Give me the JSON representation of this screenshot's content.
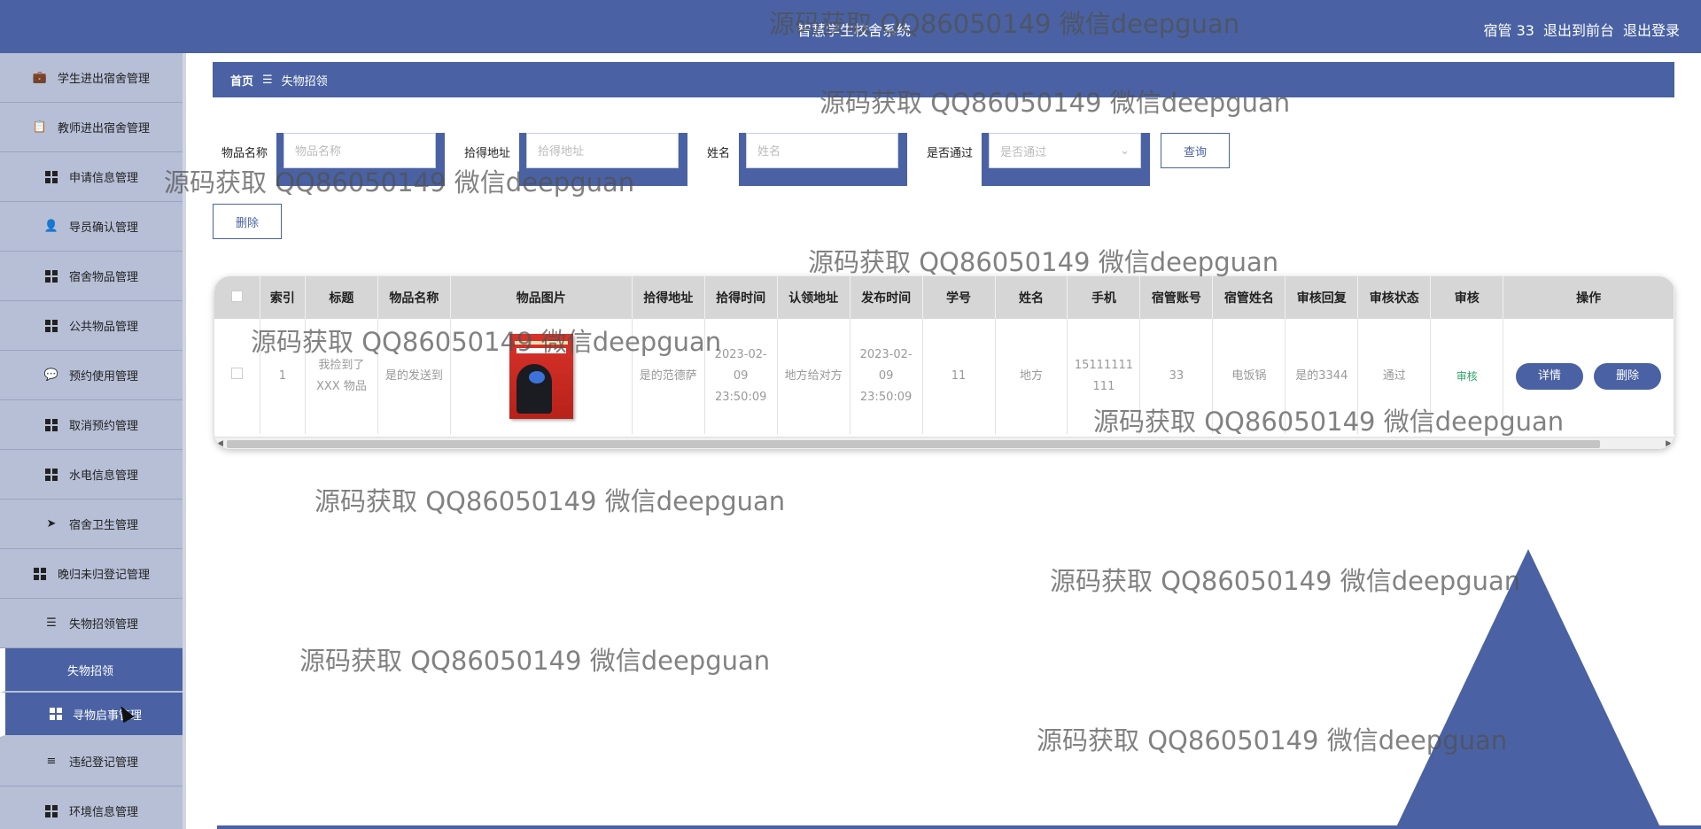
{
  "header": {
    "title": "智慧学生校舍系统",
    "user": "宿管 33",
    "to_front": "退出到前台",
    "logout": "退出登录"
  },
  "sidebar": {
    "items": [
      {
        "label": "学生进出宿舍管理",
        "icon": "briefcase-icon"
      },
      {
        "label": "教师进出宿舍管理",
        "icon": "clipboard-icon"
      },
      {
        "label": "申请信息管理",
        "icon": "grid-icon"
      },
      {
        "label": "导员确认管理",
        "icon": "user-icon"
      },
      {
        "label": "宿舍物品管理",
        "icon": "grid-icon"
      },
      {
        "label": "公共物品管理",
        "icon": "grid-icon"
      },
      {
        "label": "预约使用管理",
        "icon": "chat-icon"
      },
      {
        "label": "取消预约管理",
        "icon": "grid-icon"
      },
      {
        "label": "水电信息管理",
        "icon": "grid-icon"
      },
      {
        "label": "宿舍卫生管理",
        "icon": "paper-plane-icon"
      },
      {
        "label": "晚归未归登记管理",
        "icon": "grid-icon"
      },
      {
        "label": "失物招领管理",
        "icon": "sliders-icon"
      }
    ],
    "sub_active": "失物招领",
    "sub_next": "寻物启事管理",
    "after": [
      {
        "label": "违纪登记管理",
        "icon": "list-icon"
      },
      {
        "label": "环境信息管理",
        "icon": "grid-icon"
      }
    ]
  },
  "breadcrumb": {
    "home": "首页",
    "separator": "☰",
    "current": "失物招领"
  },
  "search": {
    "item_name_label": "物品名称",
    "item_name_placeholder": "物品名称",
    "pick_addr_label": "拾得地址",
    "pick_addr_placeholder": "拾得地址",
    "name_label": "姓名",
    "name_placeholder": "姓名",
    "pass_label": "是否通过",
    "pass_placeholder": "是否通过",
    "query_btn": "查询"
  },
  "delete_btn": "删除",
  "table": {
    "headers": [
      "索引",
      "标题",
      "物品名称",
      "物品图片",
      "拾得地址",
      "拾得时间",
      "认领地址",
      "发布时间",
      "学号",
      "姓名",
      "手机",
      "宿管账号",
      "宿管姓名",
      "审核回复",
      "审核状态",
      "审核",
      "操作"
    ],
    "rows": [
      {
        "index": "1",
        "title": "我捡到了XXX 物品",
        "item_name": "是的发送到",
        "pick_addr": "是的范德萨",
        "pick_time": "2023-02-09 23:50:09",
        "claim_addr": "地方给对方",
        "publish_time": "2023-02-09 23:50:09",
        "student_no": "11",
        "name": "地方",
        "phone": "15111111111",
        "manager_account": "33",
        "manager_name": "电饭锅",
        "audit_reply": "是的3344",
        "audit_status": "通过",
        "audit_link": "审核",
        "detail_btn": "详情",
        "delete_btn": "删除"
      }
    ]
  },
  "watermark_text": "源码获取 QQ86050149 微信deepguan",
  "colors": {
    "primary": "#4a62a3",
    "sidebar_bg": "#b6bfd6",
    "table_header_bg": "#d6d6d6",
    "audit_link": "#2ea86a"
  }
}
